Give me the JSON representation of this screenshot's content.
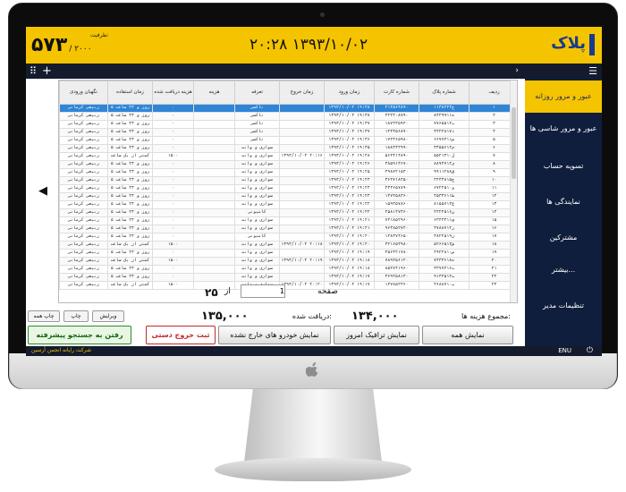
{
  "header": {
    "count": "۵۷۳",
    "capacity": "/ ۲۰۰۰",
    "capacity_label": "ظرفیت:",
    "datetime": "۲۰:۲۸   ۱۳۹۳/۱۰/۰۲",
    "logo_text": "پلاک",
    "brand_color": "#f5c400"
  },
  "sidebar": {
    "items": [
      {
        "label": "عبور و مرور روزانه"
      },
      {
        "label": "عبور و مرور شاسی ها"
      },
      {
        "label": "تسویه حساب"
      },
      {
        "label": "نمایندگی ها"
      },
      {
        "label": "مشترکین"
      },
      {
        "label": "بیشتر..."
      },
      {
        "label": "تنظیمات مدیر"
      }
    ]
  },
  "table": {
    "columns": [
      "ردیف",
      "شماره پلاک",
      "شماره کارت",
      "زمان ورود",
      "زمان خروج",
      "تعرفه",
      "هزینه",
      "هزینه دریافت شده",
      "زمان استفاده",
      "نگهبان ورودی"
    ],
    "rows": [
      [
        "۱",
        "۱۱ج۳۸۴۴۴",
        "۲۱۴۵۶۴۸۹۰",
        "۱۳۹۳/۱۰/۰۲ ۱۹:۳۸",
        "",
        "تاکسی",
        "",
        "۰",
        "۵ روز و ۲۳ ساعت",
        "ربیعی کرمانی"
      ],
      [
        "۲",
        "۸۴ه۲۹۹۱۱",
        "۴۲۲۲۰۸۷۹۰",
        "۱۳۹۳/۱۰/۰۲ ۱۹:۳۸",
        "",
        "تاکسی",
        "",
        "۰",
        "۵ روز و ۲۳ ساعت",
        "ربیعی کرمانی"
      ],
      [
        "۳",
        "۷۷ب۶۵۵۱۲",
        "۱۸۷۲۳۵۹۴۰",
        "۱۳۹۳/۱۰/۰۲ ۱۹:۳۷",
        "",
        "تاکسی",
        "",
        "۰",
        "۵ روز و ۲۳ ساعت",
        "ربیعی کرمانی"
      ],
      [
        "۴",
        "۴۴د۲۲۸۱۷",
        "۱۲۳۴۵۶۸۹۰",
        "۱۳۹۳/۱۰/۰۲ ۱۹:۳۷",
        "",
        "تاکسی",
        "",
        "۰",
        "۵ روز و ۲۳ ساعت",
        "ربیعی کرمانی"
      ],
      [
        "۵",
        "۶۶س۷۷۴۱۱",
        "۱۷۲۳۶۵۹۸۰",
        "۱۳۹۳/۱۰/۰۲ ۱۹:۳۶",
        "",
        "تاکسی",
        "",
        "۰",
        "۵ روز و ۲۳ ساعت",
        "ربیعی کرمانی"
      ],
      [
        "۶",
        "۳۳م۵۵۶۱۲",
        "۱۸۸۴۴۲۹۹۰",
        "۱۳۹۳/۱۰/۰۲ ۱۹:۳۵",
        "",
        "سواری و وانت",
        "",
        "۰",
        "۵ روز و ۲۳ ساعت",
        "ربیعی کرمانی"
      ],
      [
        "۷",
        "۵۵ل۲۱۳۱۰",
        "۵۶۲۳۱۴۸۹۰",
        "۱۳۹۳/۱۰/۰۲ ۱۹:۲۸",
        "۱۳۹۳/۱۰/۰۲ ۲۰:۱۶",
        "سواری و وانت",
        "",
        "۱۵۰۰",
        "کمتر از یک ساعت",
        "ربیعی کرمانی"
      ],
      [
        "۸",
        "۸۸ی۹۴۷۱۲",
        "۴۸۵۹۱۳۶۷۰",
        "۱۳۹۳/۱۰/۰۲ ۱۹:۲۶",
        "",
        "سواری و وانت",
        "",
        "۰",
        "۵ روز و ۲۳ ساعت",
        "ربیعی کرمانی"
      ],
      [
        "۹",
        "۹۹ق۱۱۲۸۸",
        "۴۹۸۷۲۱۵۳۰",
        "۱۳۹۳/۱۰/۰۲ ۱۹:۲۵",
        "",
        "سواری و وانت",
        "",
        "۰",
        "۵ روز و ۲۳ ساعت",
        "ربیعی کرمانی"
      ],
      [
        "۱۰",
        "۲۲ج۴۴۸۱۵",
        "۳۶۲۷۱۸۴۵۰",
        "۱۳۹۳/۱۰/۰۲ ۱۹:۲۴",
        "",
        "سواری و وانت",
        "",
        "۰",
        "۵ روز و ۲۳ ساعت",
        "ربیعی کرمانی"
      ],
      [
        "۱۱",
        "۶۷و۲۲۵۱۰",
        "۲۳۴۶۵۷۸۹۰",
        "۱۳۹۳/۱۰/۰۲ ۱۹:۲۴",
        "",
        "سواری و وانت",
        "",
        "۰",
        "۵ روز و ۲۳ ساعت",
        "ربیعی کرمانی"
      ],
      [
        "۱۲",
        "۲۵ط۳۳۶۱۱",
        "۱۴۷۲۵۸۳۶۰",
        "۱۳۹۳/۱۰/۰۲ ۱۹:۲۳",
        "",
        "سواری و وانت",
        "",
        "۰",
        "۵ روز و ۲۳ ساعت",
        "ربیعی کرمانی"
      ],
      [
        "۱۳",
        "۸۱ع۵۵۷۱۴",
        "۱۵۹۳۵۷۸۶۰",
        "۱۳۹۳/۱۰/۰۲ ۱۹:۲۲",
        "",
        "سواری و وانت",
        "",
        "۰",
        "۵ روز و ۲۳ ساعت",
        "ربیعی کرمانی"
      ],
      [
        "۱۴",
        "۲۴ن۲۲۵۱۶",
        "۲۵۸۱۴۷۳۶۰",
        "۱۳۹۳/۱۰/۰۲ ۱۹:۲۲",
        "",
        "کامیونی",
        "",
        "۰",
        "۵ روز و ۲۳ ساعت",
        "ربیعی کرمانی"
      ],
      [
        "۱۵",
        "۶۳ف۴۴۳۱۱",
        "۷۴۱۸۵۲۹۶۰",
        "۱۳۹۳/۱۰/۰۲ ۱۹:۲۱",
        "",
        "سواری و وانت",
        "",
        "۰",
        "۵ روز و ۲۳ ساعت",
        "ربیعی کرمانی"
      ],
      [
        "۱۶",
        "۴۷ر۸۸۷۱۲",
        "۹۶۳۸۵۲۷۴۰",
        "۱۳۹۳/۱۰/۰۲ ۱۹:۲۱",
        "",
        "سواری و وانت",
        "",
        "۰",
        "۵ روز و ۲۳ ساعت",
        "ربیعی کرمانی"
      ],
      [
        "۱۷",
        "۳۸ز۲۲۵۱۹",
        "۱۲۸۳۷۴۶۵۰",
        "۱۳۹۳/۱۰/۰۲ ۱۹:۲۰",
        "",
        "کامیونی",
        "",
        "۰",
        "۵ روز و ۲۳ ساعت",
        "ربیعی کرمانی"
      ],
      [
        "۱۸",
        "۵۲ش۶۶۵۱۴",
        "۳۲۱۶۵۴۹۸۰",
        "۱۳۹۳/۱۰/۰۲ ۱۹:۲۰",
        "۱۳۹۳/۱۰/۰۲ ۲۰:۱۸",
        "سواری و وانت",
        "",
        "۱۵۰۰",
        "کمتر از یک ساعت",
        "ربیعی کرمانی"
      ],
      [
        "۱۹",
        "۲۹ص۲۲۸۱۰",
        "۴۵۶۳۲۱۷۸۰",
        "۱۳۹۳/۱۰/۰۲ ۱۹:۱۹",
        "",
        "سواری و وانت",
        "",
        "۰",
        "۵ روز و ۲۳ ساعت",
        "ربیعی کرمانی"
      ],
      [
        "۲۰",
        "۷۴ه۳۳۶۱۸",
        "۷۸۹۴۵۶۱۲۰",
        "۱۳۹۳/۱۰/۰۲ ۱۹:۱۸",
        "۱۳۹۳/۱۰/۰۲ ۲۰:۱۹",
        "سواری و وانت",
        "",
        "۱۵۰۰",
        "کمتر از یک ساعت",
        "ربیعی کرمانی"
      ],
      [
        "۲۱",
        "۳۳ب۷۷۴۱۶",
        "۸۵۲۷۴۱۹۶۰",
        "۱۳۹۳/۱۰/۰۲ ۱۹:۱۸",
        "",
        "سواری و وانت",
        "",
        "۰",
        "۵ روز و ۲۳ ساعت",
        "ربیعی کرمانی"
      ],
      [
        "۲۲",
        "۹۱ت۴۴۵۱۲",
        "۳۶۹۲۵۸۱۴۰",
        "۱۳۹۳/۱۰/۰۲ ۱۹:۱۷",
        "",
        "سواری و وانت",
        "",
        "۰",
        "۵ روز و ۲۳ ساعت",
        "ربیعی کرمانی"
      ],
      [
        "۲۳",
        "۴۶پ۸۸۷۱۰",
        "۱۴۷۸۵۲۳۶۰",
        "۱۳۹۳/۱۰/۰۲ ۱۹:۱۷",
        "۱۳۹۳/۱۰/۰۲ ۲۰:۲۰",
        "سواری و وانت",
        "",
        "۱۵۰۰",
        "کمتر از یک ساعت",
        "ربیعی کرمانی"
      ]
    ]
  },
  "pager": {
    "label": "صفحه",
    "current": "1",
    "of_label": "از",
    "total": "۲۵"
  },
  "summary": {
    "total_cost_label": "مجموع هزینه ها:",
    "total_cost": "۱۳۴,۰۰۰",
    "received_label": "دریافت شده:",
    "received": "۱۳۵,۰۰۰"
  },
  "actions": {
    "show_all": "نمایش همه",
    "show_today": "نمایش ترافیک امروز",
    "show_not_exited": "نمایش خودرو های خارج نشده",
    "manual_exit": "ثبت خروج دستی",
    "advanced_search": "رفتن به جستجو پیشرفته",
    "edit": "ویرایش",
    "print": "چاپ",
    "print_all": "چاپ همه"
  },
  "footer": {
    "company": "شرکت رایانه انجمن آرسین",
    "lang": "ENU"
  }
}
